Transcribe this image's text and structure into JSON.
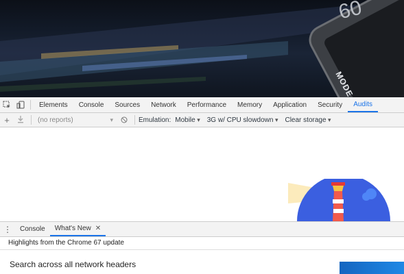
{
  "hero": {
    "number": "60",
    "label": "MODE"
  },
  "toolbar": {
    "inspect_icon": "cursor-select-icon",
    "device_icon": "device-toggle-icon",
    "tabs": [
      "Elements",
      "Console",
      "Sources",
      "Network",
      "Performance",
      "Memory",
      "Application",
      "Security",
      "Audits"
    ],
    "active_tab": "Audits",
    "accent": "#1a73e8"
  },
  "audits_bar": {
    "add_icon": "plus-icon",
    "download_icon": "download-icon",
    "reports_placeholder": "(no reports)",
    "clear_icon": "block-icon",
    "emulation_label": "Emulation:",
    "emulation_value": "Mobile",
    "throttling_value": "3G w/ CPU slowdown",
    "storage_value": "Clear storage"
  },
  "drawer": {
    "menu_icon": "kebab-menu-icon",
    "tabs": [
      "Console",
      "What's New"
    ],
    "active_tab": "What's New",
    "close_icon": "close-icon",
    "highlight": "Highlights from the Chrome 67 update",
    "item_title": "Search across all network headers"
  }
}
